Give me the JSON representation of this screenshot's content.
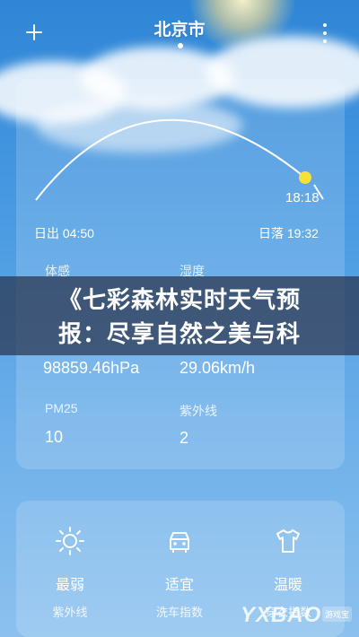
{
  "header": {
    "title": "北京市",
    "add_icon": "plus-icon",
    "more_icon": "more-vertical-icon"
  },
  "sun": {
    "current_time": "18:18",
    "sunrise": "日出 04:50",
    "sunset": "日落 19:32"
  },
  "details": {
    "feels_like_label": "体感",
    "humidity_label": "湿度",
    "pressure_value": "98859.46hPa",
    "wind_value": "29.06km/h",
    "pm25_label": "PM25",
    "pm25_value": "10",
    "uv_label": "紫外线",
    "uv_value": "2"
  },
  "banner": {
    "line1": "《七彩森林实时天气预",
    "line2": "报：尽享自然之美与科"
  },
  "indices": [
    {
      "icon": "sun-icon",
      "level": "最弱",
      "name": "紫外线"
    },
    {
      "icon": "car-icon",
      "level": "适宜",
      "name": "洗车指数"
    },
    {
      "icon": "tshirt-icon",
      "level": "温暖",
      "name": "穿衣指数"
    }
  ],
  "watermark": {
    "text": "YXBAO",
    "badge": "游戏宝"
  },
  "colors": {
    "sky_top": "#2f86d6",
    "sky_bottom": "#8cc1ee",
    "sun_dot": "#f5e13a",
    "banner_bg": "#283048"
  }
}
